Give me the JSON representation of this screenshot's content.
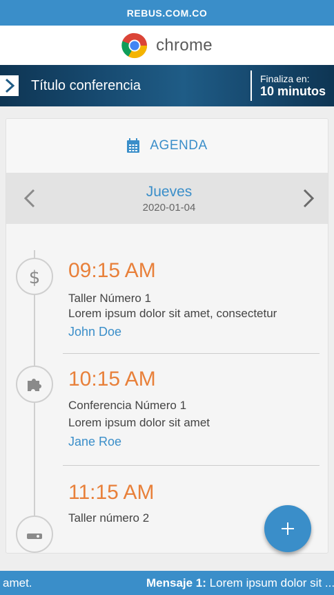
{
  "site": {
    "domain": "REBUS.COM.CO"
  },
  "brand": {
    "name": "chrome"
  },
  "conference": {
    "title": "Título conferencia",
    "ends_label": "Finaliza en:",
    "ends_value": "10 minutos"
  },
  "agenda": {
    "title": "AGENDA",
    "day": {
      "name": "Jueves",
      "date": "2020-01-04"
    },
    "events": [
      {
        "time": "09:15 AM",
        "name": "Taller Número 1",
        "desc": "Lorem ipsum dolor sit amet, consectetur",
        "speaker": "John Doe",
        "icon": "dollar-icon"
      },
      {
        "time": "10:15 AM",
        "name": "Conferencia Número 1",
        "desc": "Lorem ipsum dolor sit amet",
        "speaker": "Jane Roe",
        "icon": "puzzle-icon"
      },
      {
        "time": "11:15 AM",
        "name": "Taller número 2",
        "desc": "",
        "speaker": "",
        "icon": "projector-icon"
      }
    ]
  },
  "ticker": {
    "prefix_fragment": "amet.",
    "message_label": "Mensaje 1:",
    "message_text": " Lorem ipsum dolor sit ..."
  },
  "colors": {
    "primary": "#3a8ec9",
    "accent": "#e8803a"
  }
}
